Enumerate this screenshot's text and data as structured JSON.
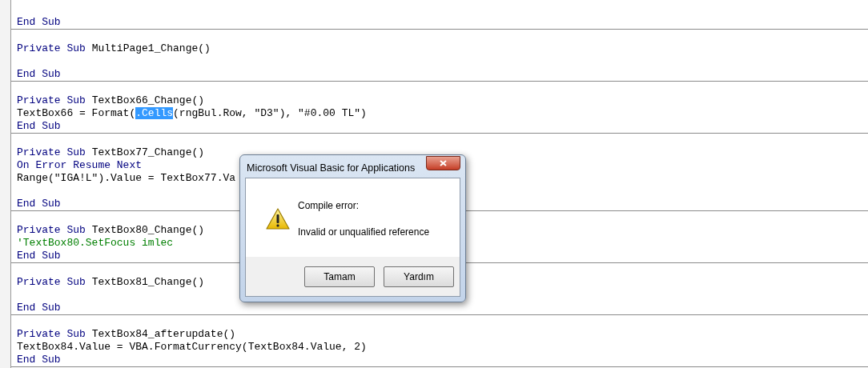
{
  "code_blocks": [
    {
      "lines": [
        {
          "segments": [
            {
              "kind": "keyword",
              "text": "End Sub"
            }
          ]
        }
      ]
    },
    {
      "lines": [
        {
          "segments": [
            {
              "kind": "keyword",
              "text": "Private Sub"
            },
            {
              "kind": "plain",
              "text": " MultiPage1_Change()"
            }
          ]
        },
        {
          "kind": "blank"
        },
        {
          "segments": [
            {
              "kind": "keyword",
              "text": "End Sub"
            }
          ]
        }
      ]
    },
    {
      "lines": [
        {
          "segments": [
            {
              "kind": "keyword",
              "text": "Private Sub"
            },
            {
              "kind": "plain",
              "text": " TextBox66_Change()"
            }
          ]
        },
        {
          "segments": [
            {
              "kind": "plain",
              "text": "TextBox66 = Format("
            },
            {
              "kind": "selected",
              "text": ".Cells"
            },
            {
              "kind": "plain",
              "text": "(rngBul.Row, \"D3\"), \"#0.00 TL\")"
            }
          ]
        },
        {
          "segments": [
            {
              "kind": "keyword",
              "text": "End Sub"
            }
          ]
        }
      ]
    },
    {
      "lines": [
        {
          "segments": [
            {
              "kind": "keyword",
              "text": "Private Sub"
            },
            {
              "kind": "plain",
              "text": " TextBox77_Change()"
            }
          ]
        },
        {
          "segments": [
            {
              "kind": "keyword",
              "text": "On Error Resume Next"
            }
          ]
        },
        {
          "segments": [
            {
              "kind": "plain",
              "text": "Range(\"IGA!L\").Value = TextBox77.Va"
            }
          ]
        },
        {
          "kind": "blank"
        },
        {
          "segments": [
            {
              "kind": "keyword",
              "text": "End Sub"
            }
          ]
        }
      ]
    },
    {
      "lines": [
        {
          "segments": [
            {
              "kind": "keyword",
              "text": "Private Sub"
            },
            {
              "kind": "plain",
              "text": " TextBox80_Change()"
            }
          ]
        },
        {
          "segments": [
            {
              "kind": "comment",
              "text": "'TextBox80.SetFocus imlec"
            }
          ]
        },
        {
          "segments": [
            {
              "kind": "keyword",
              "text": "End Sub"
            }
          ]
        }
      ]
    },
    {
      "lines": [
        {
          "segments": [
            {
              "kind": "keyword",
              "text": "Private Sub"
            },
            {
              "kind": "plain",
              "text": " TextBox81_Change()"
            }
          ]
        },
        {
          "kind": "blank"
        },
        {
          "segments": [
            {
              "kind": "keyword",
              "text": "End Sub"
            }
          ]
        }
      ]
    },
    {
      "lines": [
        {
          "segments": [
            {
              "kind": "keyword",
              "text": "Private Sub"
            },
            {
              "kind": "plain",
              "text": " TextBox84_afterupdate()"
            }
          ]
        },
        {
          "segments": [
            {
              "kind": "plain",
              "text": "TextBox84.Value = VBA.FormatCurrency(TextBox84.Value, 2)"
            }
          ]
        },
        {
          "segments": [
            {
              "kind": "keyword",
              "text": "End Sub"
            }
          ]
        }
      ]
    }
  ],
  "dialog": {
    "title": "Microsoft Visual Basic for Applications",
    "heading": "Compile error:",
    "message": "Invalid or unqualified reference",
    "buttons": [
      {
        "label": "Tamam"
      },
      {
        "label": "Yardım"
      }
    ]
  }
}
